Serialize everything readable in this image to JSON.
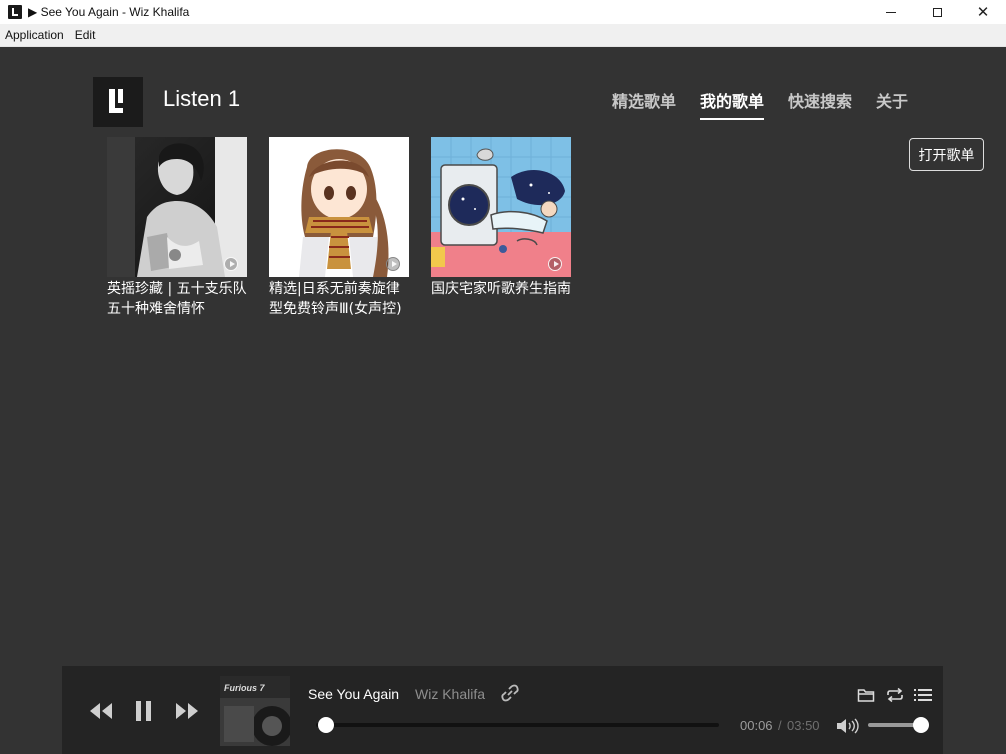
{
  "window": {
    "title": "▶ See You Again - Wiz Khalifa",
    "controls": {
      "minimize": "minimize-icon",
      "maximize": "maximize-icon",
      "close": "✕"
    }
  },
  "menubar": {
    "items": [
      "Application",
      "Edit"
    ]
  },
  "header": {
    "app_name": "Listen 1",
    "tabs": [
      {
        "label": "精选歌单",
        "active": false
      },
      {
        "label": "我的歌单",
        "active": true
      },
      {
        "label": "快速搜索",
        "active": false
      },
      {
        "label": "关于",
        "active": false
      }
    ],
    "open_playlist_label": "打开歌单"
  },
  "playlists": [
    {
      "title": "英摇珍藏 | 五十支乐队五十种难舍情怀",
      "cover": "black-and-white-portrait"
    },
    {
      "title": "精选|日系无前奏旋律型免费铃声Ⅲ(女声控)",
      "cover": "anime-girl-scarf"
    },
    {
      "title": "国庆宅家听歌养生指南",
      "cover": "washing-machine-illustration"
    }
  ],
  "player": {
    "song_title": "See You Again",
    "artist": "Wiz Khalifa",
    "album_art": "Furious 7",
    "current_time": "00:06",
    "time_separator": "/",
    "total_time": "03:50",
    "progress": 0.026,
    "volume": 0.95,
    "icons": [
      "prev-icon",
      "pause-icon",
      "next-icon",
      "link-icon",
      "volume-icon",
      "folder-icon",
      "repeat-icon",
      "playlist-icon"
    ]
  },
  "colors": {
    "background": "#333333",
    "player_background": "#242424",
    "text_primary": "#ffffff",
    "text_secondary": "#8e8e8e"
  }
}
